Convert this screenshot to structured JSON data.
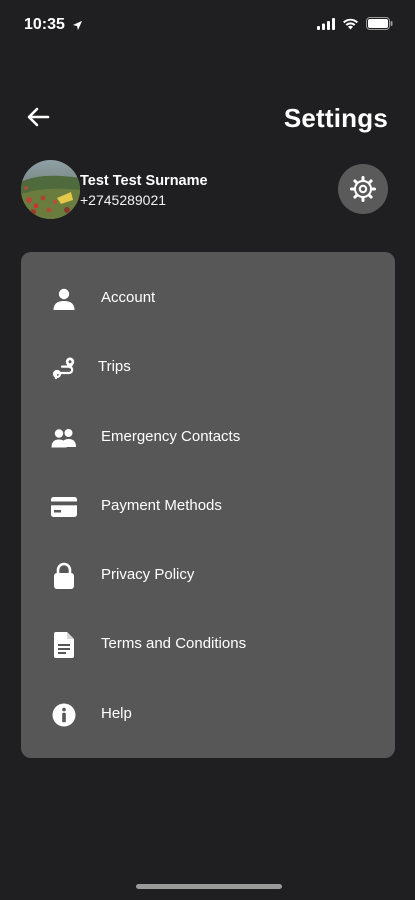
{
  "status_bar": {
    "time": "10:35"
  },
  "header": {
    "title": "Settings",
    "back_icon": "arrow-left-icon"
  },
  "profile": {
    "name": "Test Test Surname",
    "phone": "+2745289021",
    "settings_icon": "gear-icon"
  },
  "menu": {
    "items": [
      {
        "label": "Account",
        "icon": "person-icon"
      },
      {
        "label": "Trips",
        "icon": "route-icon"
      },
      {
        "label": "Emergency Contacts",
        "icon": "people-icon"
      },
      {
        "label": "Payment Methods",
        "icon": "credit-card-icon"
      },
      {
        "label": "Privacy Policy",
        "icon": "lock-icon"
      },
      {
        "label": "Terms and Conditions",
        "icon": "document-icon"
      },
      {
        "label": "Help",
        "icon": "info-icon"
      }
    ]
  },
  "colors": {
    "background": "#1f1f21",
    "card": "#575757",
    "text": "#ffffff",
    "button": "#5a5a5a"
  }
}
